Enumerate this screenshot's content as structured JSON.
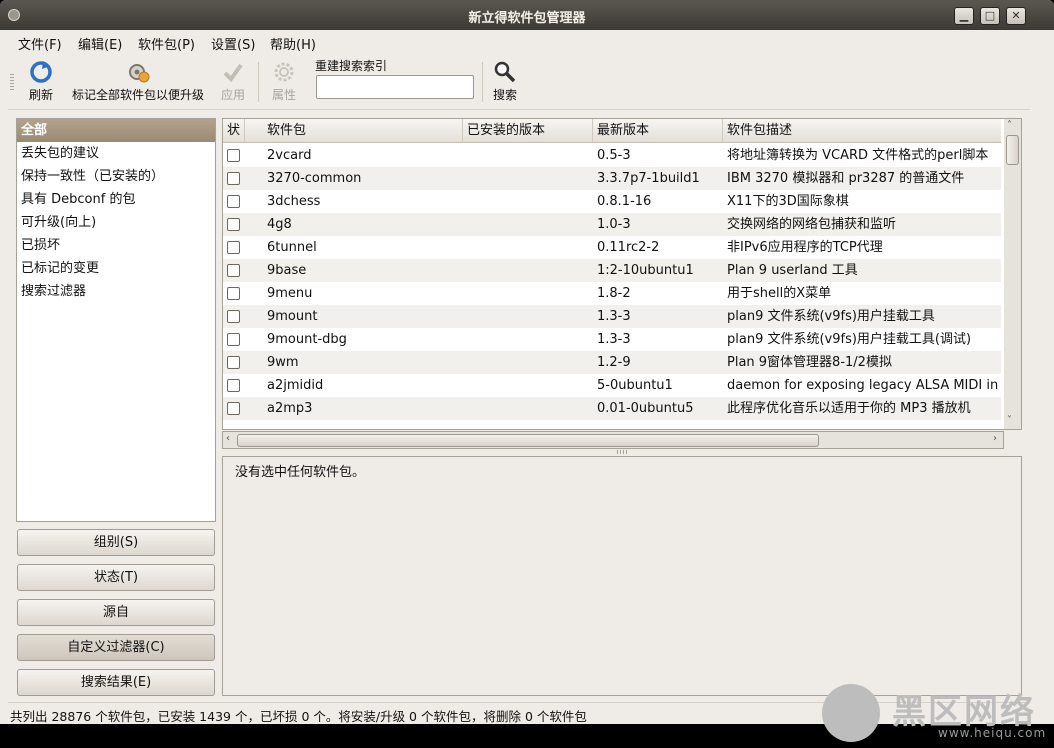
{
  "window": {
    "title": "新立得软件包管理器"
  },
  "menubar": {
    "items": [
      {
        "label": "文件(F)"
      },
      {
        "label": "编辑(E)"
      },
      {
        "label": "软件包(P)"
      },
      {
        "label": "设置(S)"
      },
      {
        "label": "帮助(H)"
      }
    ]
  },
  "toolbar": {
    "refresh": "刷新",
    "mark_upgrades": "标记全部软件包以便升级",
    "apply": "应用",
    "properties": "属性",
    "search_label": "重建搜索索引",
    "search_value": "",
    "search": "搜索"
  },
  "filters": {
    "items": [
      {
        "label": "全部",
        "selected": true
      },
      {
        "label": "丢失包的建议"
      },
      {
        "label": "保持一致性（已安装的）"
      },
      {
        "label": "具有 Debconf 的包"
      },
      {
        "label": "可升级(向上)"
      },
      {
        "label": "已损坏"
      },
      {
        "label": "已标记的变更"
      },
      {
        "label": "搜索过滤器"
      }
    ],
    "buttons": {
      "groups": "组别(S)",
      "status": "状态(T)",
      "origin": "源自",
      "custom": "自定义过滤器(C)",
      "search_results": "搜索结果(E)"
    }
  },
  "table": {
    "columns": {
      "status": "状",
      "package": "软件包",
      "installed": "已安装的版本",
      "latest": "最新版本",
      "description": "软件包描述"
    },
    "rows": [
      {
        "name": "2vcard",
        "installed": "",
        "latest": "0.5-3",
        "desc": "将地址簿转换为 VCARD 文件格式的perl脚本"
      },
      {
        "name": "3270-common",
        "installed": "",
        "latest": "3.3.7p7-1build1",
        "desc": "IBM 3270 模拟器和 pr3287 的普通文件"
      },
      {
        "name": "3dchess",
        "installed": "",
        "latest": "0.8.1-16",
        "desc": "X11下的3D国际象棋"
      },
      {
        "name": "4g8",
        "installed": "",
        "latest": "1.0-3",
        "desc": "交换网络的网络包捕获和监听"
      },
      {
        "name": "6tunnel",
        "installed": "",
        "latest": "0.11rc2-2",
        "desc": "非IPv6应用程序的TCP代理"
      },
      {
        "name": "9base",
        "installed": "",
        "latest": "1:2-10ubuntu1",
        "desc": "Plan 9 userland 工具"
      },
      {
        "name": "9menu",
        "installed": "",
        "latest": "1.8-2",
        "desc": "用于shell的X菜单"
      },
      {
        "name": "9mount",
        "installed": "",
        "latest": "1.3-3",
        "desc": "plan9 文件系统(v9fs)用户挂载工具"
      },
      {
        "name": "9mount-dbg",
        "installed": "",
        "latest": "1.3-3",
        "desc": "plan9 文件系统(v9fs)用户挂载工具(调试)"
      },
      {
        "name": "9wm",
        "installed": "",
        "latest": "1.2-9",
        "desc": "Plan 9窗体管理器8-1/2模拟"
      },
      {
        "name": "a2jmidid",
        "installed": "",
        "latest": "5-0ubuntu1",
        "desc": "daemon for exposing legacy ALSA MIDI in"
      },
      {
        "name": "a2mp3",
        "installed": "",
        "latest": "0.01-0ubuntu5",
        "desc": "此程序优化音乐以适用于你的 MP3 播放机"
      }
    ]
  },
  "description": {
    "text": "没有选中任何软件包。"
  },
  "statusbar": {
    "text": "共列出 28876 个软件包，已安装 1439 个，已坏损 0 个。将安装/升级 0 个软件包，将删除 0 个软件包"
  },
  "watermark": {
    "text": "黑区网络",
    "sub": "www.heiqu.com"
  }
}
